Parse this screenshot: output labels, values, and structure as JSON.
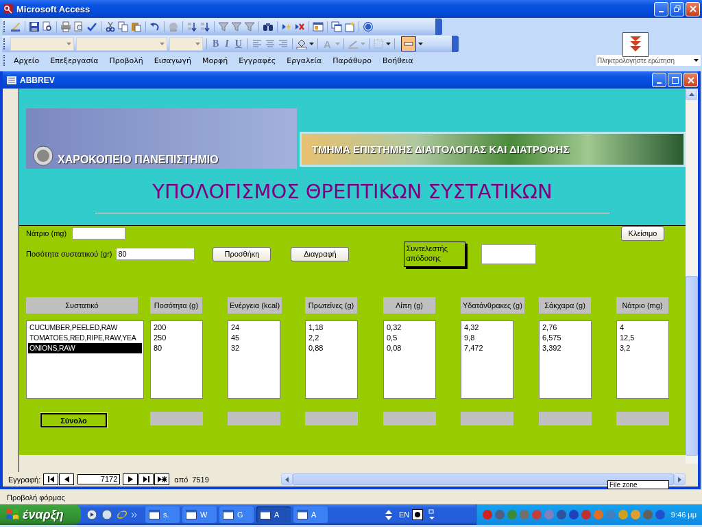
{
  "app_window": {
    "title": "Microsoft Access"
  },
  "format_toolbar": {
    "bold": "B",
    "italic": "I",
    "underline": "U",
    "font_color": "A"
  },
  "menu": [
    "Αρχείο",
    "Επεξεργασία",
    "Προβολή",
    "Εισαγωγή",
    "Μορφή",
    "Εγγραφές",
    "Εργαλεία",
    "Παράθυρο",
    "Βοήθεια"
  ],
  "question_box": {
    "placeholder": "Πληκτρολογήστε ερώτηση"
  },
  "form_window": {
    "title": "ABBREV"
  },
  "header": {
    "university": "ΧΑΡΟΚΟΠΕΙΟ ΠΑΝΕΠΙΣΤΗΜΙΟ",
    "department": "ΤΜΗΜΑ ΕΠΙΣΤΗΜΗΣ ΔΙΑΙΤΟΛΟΓΙΑΣ ΚΑΙ ΔΙΑΤΡΟΦΗΣ",
    "heading": "ΥΠΟΛΟΓΙΣΜΟΣ ΘΡΕΠΤΙΚΩΝ ΣΥΣΤΑΤΙΚΩΝ"
  },
  "sodium_field": {
    "label": "Νάτριο (mg)"
  },
  "close_button": "Κλείσιμο",
  "quantity_field": {
    "label": "Ποσότητα συστατικού  (gr)",
    "value": "80"
  },
  "buttons": [
    "Προσθήκη",
    "Διαγραφή"
  ],
  "yield_factor": {
    "label": "Συντελεστής απόδοσης"
  },
  "ingredients": {
    "heading": "Συστατικό",
    "items": [
      {
        "text": "CUCUMBER,PEELED,RAW",
        "selected": false
      },
      {
        "text": "TOMATOES,RED,RIPE,RAW,YEA",
        "selected": false
      },
      {
        "text": "ONIONS,RAW",
        "selected": true
      }
    ]
  },
  "nutrient_columns": [
    {
      "heading": "Ποσότητα (g)",
      "values": [
        "200",
        "250",
        "80"
      ]
    },
    {
      "heading": "Ενέργεια (kcal)",
      "values": [
        "24",
        "45",
        "32"
      ]
    },
    {
      "heading": "Πρωτεΐνες (g)",
      "values": [
        "1,18",
        "2,2",
        "0,88"
      ]
    },
    {
      "heading": "Λίπη (g)",
      "values": [
        "0,32",
        "0,5",
        "0,08"
      ]
    },
    {
      "heading": "Υδατάνθρακες (g)",
      "values": [
        "4,32",
        "9,8",
        "7,472"
      ]
    },
    {
      "heading": "Σάκχαρα (g)",
      "values": [
        "2,76",
        "6,575",
        "3,392"
      ]
    },
    {
      "heading": "Νάτριο (mg)",
      "values": [
        "4",
        "12,5",
        "3,2"
      ]
    }
  ],
  "total_button": "Σύνολο",
  "record_nav": {
    "label": "Εγγραφή:",
    "current": "7172",
    "of_label": "από",
    "total": "7519"
  },
  "tooltip": "File zone",
  "status_bar": {
    "text": "Προβολή φόρμας"
  },
  "taskbar": {
    "start": "έναρξη",
    "tasks": [
      {
        "label": "s.",
        "selected": false
      },
      {
        "label": "W",
        "selected": false
      },
      {
        "label": "G",
        "selected": false
      },
      {
        "label": "A",
        "selected": true
      },
      {
        "label": "A",
        "selected": false
      }
    ],
    "language": "EN",
    "clock": "9:46 μμ"
  }
}
